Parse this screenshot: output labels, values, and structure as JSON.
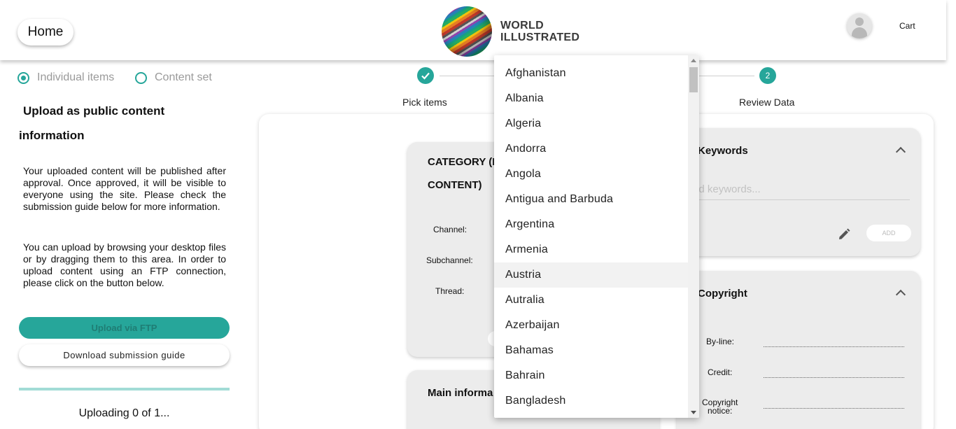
{
  "header": {
    "home_label": "Home",
    "logo_line1": "WORLD",
    "logo_line2": "ILLUSTRATED",
    "cart_label": "Cart"
  },
  "sidebar": {
    "radio_individual": "Individual items",
    "radio_content_set": "Content set",
    "title_line1": "Upload as public content",
    "title_line2": "information",
    "para1": "Your uploaded content will be published after approval. Once approved, it will be visible to everyone using the site. Please check the submission guide below for more information.",
    "para2": "You can upload by browsing your desktop files or by dragging them to this area. In order to upload content using an FTP connection, please click on the button below.",
    "ftp_button": "Upload via FTP",
    "guide_button": "Download submission guide",
    "uploading_status": "Uploading 0 of 1..."
  },
  "stepper": {
    "step1_label": "Pick items",
    "step2_number": "2",
    "step2_label": "Review Data"
  },
  "category_card": {
    "title_line1": "CATEGORY (I",
    "title_line2": "CONTENT)",
    "channel_label": "Channel:",
    "subchannel_label": "Subchannel:",
    "thread_label": "Thread:"
  },
  "main_info_card": {
    "title": "Main informa"
  },
  "keywords_card": {
    "title": "Keywords",
    "placeholder": "dd keywords...",
    "add_button": "ADD"
  },
  "copyright_card": {
    "title": "Copyright",
    "byline_label": "By-line:",
    "credit_label": "Credit:",
    "notice_line1": "Copyright",
    "notice_line2": "notice:"
  },
  "country_dropdown": {
    "items": [
      "Afghanistan",
      "Albania",
      "Algeria",
      "Andorra",
      "Angola",
      "Antigua and Barbuda",
      "Argentina",
      "Armenia",
      "Austria",
      "Autralia",
      "Azerbaijan",
      "Bahamas",
      "Bahrain",
      "Bangladesh"
    ],
    "hovered": "Austria"
  },
  "colors": {
    "accent": "#26a69a",
    "card_bg": "#ececec"
  }
}
